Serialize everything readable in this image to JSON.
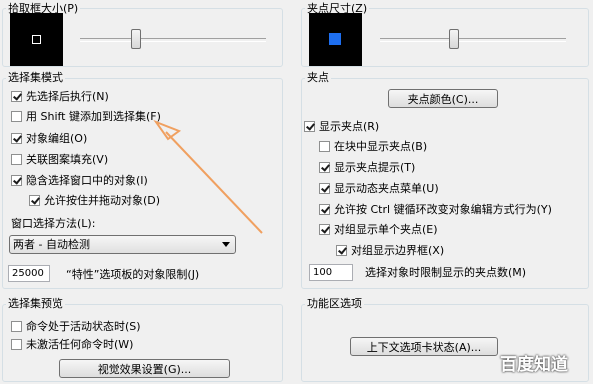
{
  "pickbox": {
    "title": "拾取框大小(P)",
    "level": 0.3
  },
  "grip_size": {
    "title": "夹点尺寸(Z)",
    "level": 0.4,
    "swatch_color": "#1e6ff0"
  },
  "selection_modes": {
    "title": "选择集模式",
    "items": [
      {
        "label": "先选择后执行(N)",
        "checked": true
      },
      {
        "label": "用 Shift 键添加到选择集(F)",
        "checked": false
      },
      {
        "label": "对象编组(O)",
        "checked": true
      },
      {
        "label": "关联图案填充(V)",
        "checked": false
      },
      {
        "label": "隐含选择窗口中的对象(I)",
        "checked": true
      },
      {
        "label": "允许按住并拖动对象(D)",
        "checked": true
      }
    ],
    "window_method_label": "窗口选择方法(L):",
    "window_method_value": "两者 - 自动检测",
    "limit_value": "25000",
    "limit_label": "“特性”选项板的对象限制(J)"
  },
  "grips": {
    "title": "夹点",
    "color_button": "夹点颜色(C)...",
    "items": [
      {
        "label": "显示夹点(R)",
        "checked": true
      },
      {
        "label": "在块中显示夹点(B)",
        "checked": false
      },
      {
        "label": "显示夹点提示(T)",
        "checked": true
      },
      {
        "label": "显示动态夹点菜单(U)",
        "checked": true
      },
      {
        "label": "允许按 Ctrl 键循环改变对象编辑方式行为(Y)",
        "checked": true
      },
      {
        "label": "对组显示单个夹点(E)",
        "checked": true
      },
      {
        "label": "对组显示边界框(X)",
        "checked": true
      }
    ],
    "limit_value": "100",
    "limit_label": "选择对象时限制显示的夹点数(M)"
  },
  "selection_preview": {
    "title": "选择集预览",
    "items": [
      {
        "label": "命令处于活动状态时(S)",
        "checked": false
      },
      {
        "label": "未激活任何命令时(W)",
        "checked": false
      }
    ],
    "button": "视觉效果设置(G)..."
  },
  "ribbon": {
    "title": "功能区选项",
    "button": "上下文选项卡状态(A)..."
  },
  "watermark": {
    "text": "百度知道"
  },
  "annotation_color": "#f0a060"
}
